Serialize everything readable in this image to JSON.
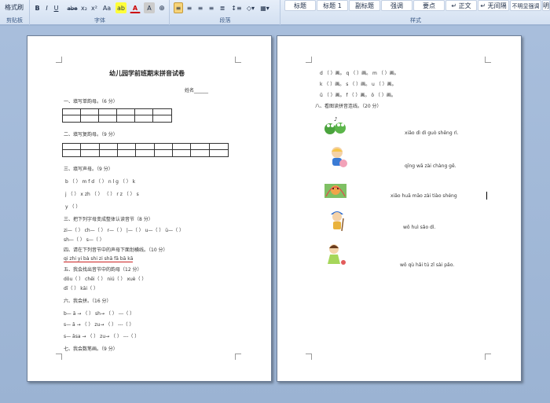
{
  "ribbon": {
    "format_painter": "格式刷",
    "clipboard_label": "剪贴板",
    "font_label": "字体",
    "paragraph_label": "段落",
    "styles_label": "样式",
    "bold": "B",
    "italic": "I",
    "underline": "U",
    "strike": "abe",
    "subscript": "x₂",
    "superscript": "x²",
    "clear_format": "Aa",
    "highlight": "ab",
    "font_color": "A",
    "char_shading": "A",
    "styles": [
      "标题",
      "标题 1",
      "副标题",
      "强调",
      "要点",
      "↵ 正文",
      "↵ 无间隔",
      "不明显强调",
      "明"
    ]
  },
  "page1": {
    "title": "幼儿园学前班期末拼音试卷",
    "name_label": "姓名",
    "q1": "一、填写单韵母。（6 分）",
    "q2": "二、填写复韵母。（9 分）",
    "q3": "三、填写声母。（9 分）",
    "q3_row1": "b （    ）  m  f  d  （    ）  n  l  g  （    ）  k",
    "q3_row2": "j  （    ）  x  zh  （    ）  （    ）  r  z  （    ）  s",
    "q3_row3": "y  （    ）",
    "q4": "三、把下列字母变成整体认读音节（8 分）",
    "q4_row1": "zi—（    ）   ch—（    ）   r—（    ）  |—（    ）      u—（    ）   ü—（    ）",
    "q4_row2": "sh—（    ）   s—（    ）",
    "q5": "四、请在下列音节中的声母下面划横线。（10 分）",
    "q5_row": "qi    zhi    yi    bà    shi    zi    shā    fā    bā    kā",
    "q6": "五、我会找出音节中的韵母（12 分）",
    "q6_row1": "dōu（    ）   chēi（    ）   niú（    ）   xuè（    ）",
    "q6_row2": "dī（    ）   kāi（    ）",
    "q7": "六、我会拼。（16 分）",
    "q7_row1": "b— ā →       （          ）          sh→ （          ）  ---（          ）",
    "q7_row2": "s— ā →       （          ）          zu→ （          ）  ---（          ）",
    "q7_row3": "s—   āsa →   （          ）          zu→ （          ）  ---（          ）",
    "q8": "七、我会数笔画。（9 分）"
  },
  "page2": {
    "row1": "d （    ）画。     q （    ）画。        m （    ）画。",
    "row2": "k （    ）画。     s （    ）画。        u （    ）画。",
    "row3": "ǔ （    ）画。     f （    ）画。        ǒ （    ）画。",
    "q9": "八、看图读拼音连线。（20 分）",
    "p1": "xiǎo dì   dì   guò   shēng   rì.",
    "p2": "qīng   wā   zài   chàng   gē.",
    "p3": "xiǎo huā māo   zài   tiào   shéng",
    "p4": "wǒ   huì   sǎo   dì.",
    "p5": "wǒ   qù   hǎi   tú   zǐ   sài   pǎo."
  }
}
